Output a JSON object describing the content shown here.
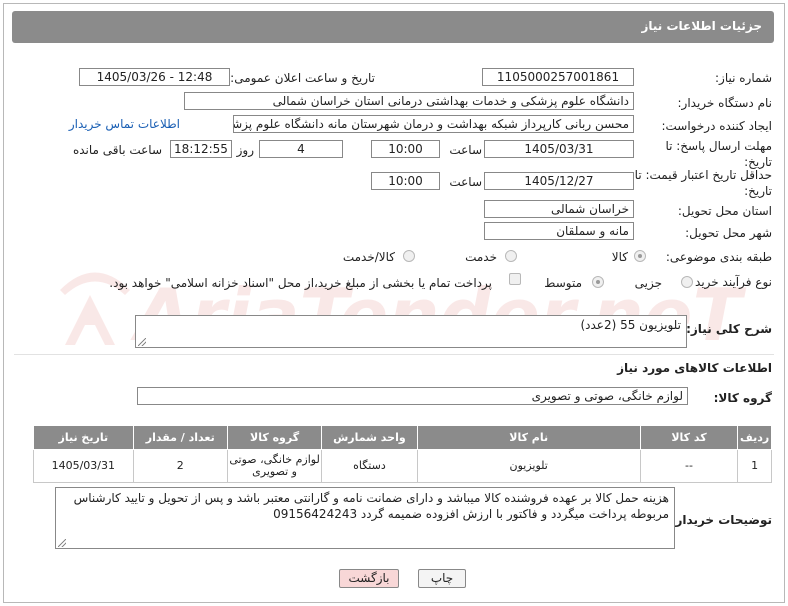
{
  "header": {
    "title": "جزئیات اطلاعات نیاز"
  },
  "labels": {
    "need_number": "شماره نیاز:",
    "announce_datetime": "تاریخ و ساعت اعلان عمومی:",
    "buyer_org": "نام دستگاه خریدار:",
    "requester": "ایجاد کننده درخواست:",
    "deadline": "مهلت ارسال پاسخ: تا تاریخ:",
    "min_price_validity": "حداقل تاریخ اعتبار قیمت: تا تاریخ:",
    "time": "ساعت",
    "day_and": "روز و",
    "remaining": "ساعت باقی مانده",
    "delivery_province": "استان محل تحویل:",
    "delivery_city": "شهر محل تحویل:",
    "category": "طبقه بندی موضوعی:",
    "process_type": "نوع فرآیند خرید :",
    "general_desc": "شرح کلی نیاز:",
    "goods_info": "اطلاعات کالاهای مورد نیاز",
    "goods_group": "گروه کالا:",
    "buyer_notes": "توضیحات خریدار:"
  },
  "fields": {
    "need_number": "1105000257001861",
    "announce_datetime": "1405/03/26 - 12:48",
    "buyer_org": "دانشگاه علوم پزشکی و خدمات بهداشتی درمانی استان خراسان شمالی",
    "requester": "محسن ربانی کارپرداز شبکه بهداشت و درمان شهرستان مانه دانشگاه علوم پزشکی و خدمات بهداشتی درمانی",
    "contact_link": "اطلاعات تماس خریدار",
    "deadline_date": "1405/03/31",
    "deadline_time": "10:00",
    "days_left": "4",
    "time_left": "18:12:55",
    "price_validity_date": "1405/12/27",
    "price_validity_time": "10:00",
    "delivery_province": "خراسان شمالی",
    "delivery_city": "مانه و سملقان",
    "general_desc": "تلویزیون 55 (2عدد)",
    "goods_group": "لوازم خانگی، صوتی و تصویری",
    "buyer_notes": "هزینه حمل کالا بر عهده فروشنده کالا میباشد و دارای ضمانت نامه و گارانتی معتبر باشد و پس از تحویل و تایید کارشناس مربوطه پرداخت میگردد و فاکتور با ارزش افزوده ضمیمه گردد 09156424243"
  },
  "category_options": [
    "کالا",
    "خدمت",
    "کالا/خدمت"
  ],
  "process_options": [
    "جزیی",
    "متوسط"
  ],
  "treasury_checkbox_label": "پرداخت تمام یا بخشی از مبلغ خرید،از محل \"اسناد خزانه اسلامی\" خواهد بود.",
  "table": {
    "headers": [
      "ردیف",
      "کد کالا",
      "نام کالا",
      "واحد شمارش",
      "گروه کالا",
      "تعداد / مقدار",
      "تاریخ نیاز"
    ],
    "rows": [
      [
        "1",
        "--",
        "تلویزیون",
        "دستگاه",
        "لوازم خانگی، صوتی و تصویری",
        "2",
        "1405/03/31"
      ]
    ]
  },
  "buttons": {
    "print": "چاپ",
    "back": "بازگشت"
  },
  "watermark": {
    "text": "AriaTender.neT"
  },
  "colors": {
    "header_bg": "#8b8b8b",
    "link": "#1a5fb4",
    "back_btn_bg": "#f8d7d7",
    "watermark": "#d9534f"
  }
}
